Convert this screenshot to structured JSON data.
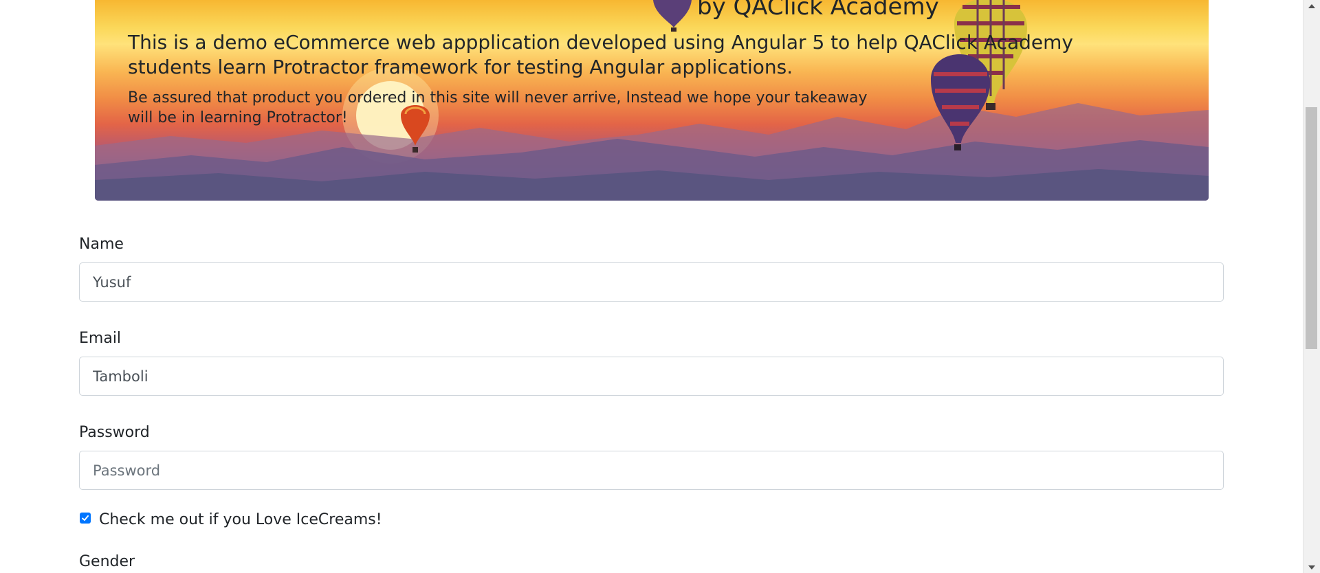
{
  "banner": {
    "subtitle": "by QAClick Academy",
    "headline": "This is a demo eCommerce web appplication developed using Angular 5 to help QAClick Academy students learn Protractor framework for testing Angular applications.",
    "note": "Be assured that product you ordered in this site will never arrive, Instead we hope your takeaway will be in learning Protractor!"
  },
  "form": {
    "name": {
      "label": "Name",
      "value": "Yusuf",
      "placeholder": ""
    },
    "email": {
      "label": "Email",
      "value": "Tamboli",
      "placeholder": ""
    },
    "password": {
      "label": "Password",
      "value": "",
      "placeholder": "Password"
    },
    "icecream": {
      "label": "Check me out if you Love IceCreams!",
      "checked": true
    },
    "gender": {
      "label": "Gender"
    }
  },
  "colors": {
    "checkbox_accent": "#0075ff",
    "input_border": "#ced4da",
    "text": "#212529",
    "scroll_thumb": "#c1c1c1"
  },
  "icons": {
    "checkbox": "checkmark-icon",
    "scroll_up": "triangle-up-icon",
    "scroll_down": "triangle-down-icon"
  }
}
